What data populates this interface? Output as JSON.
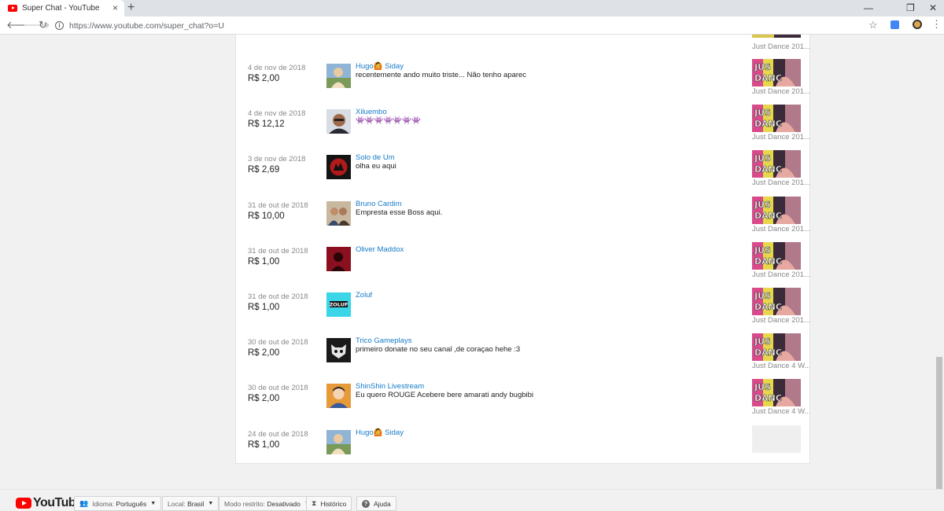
{
  "browser": {
    "tab_title": "Super Chat - YouTube",
    "close_glyph": "×",
    "new_tab_glyph": "+",
    "url": "https://www.youtube.com/super_chat?o=U",
    "window_controls": [
      "—",
      "❐",
      "✕"
    ]
  },
  "top_partial": {
    "thumb_title": "Just Dance 201..."
  },
  "rows": [
    {
      "date": "4 de nov de 2018",
      "amount": "R$ 2,00",
      "user": "Hugo🙆 Siday",
      "message": "recentemente ando muito triste... Não tenho aparec",
      "video_title": "Just Dance 201...",
      "avatar": "hugo"
    },
    {
      "date": "4 de nov de 2018",
      "amount": "R$ 12,12",
      "user": "Xiluembo",
      "message": "👾👾👾👾👾👾👾",
      "video_title": "Just Dance 201...",
      "avatar": "xiluembo"
    },
    {
      "date": "3 de nov de 2018",
      "amount": "R$ 2,69",
      "user": "Solo de Um",
      "message": "olha eu aqui",
      "video_title": "Just Dance 201...",
      "avatar": "solo"
    },
    {
      "date": "31 de out de 2018",
      "amount": "R$ 10,00",
      "user": "Bruno Cardim",
      "message": "Empresta esse Boss aqui.",
      "video_title": "Just Dance 201...",
      "avatar": "bruno"
    },
    {
      "date": "31 de out de 2018",
      "amount": "R$ 1,00",
      "user": "Oliver Maddox",
      "message": "",
      "video_title": "Just Dance 201...",
      "avatar": "oliver"
    },
    {
      "date": "31 de out de 2018",
      "amount": "R$ 1,00",
      "user": "Zoluf",
      "message": "",
      "video_title": "Just Dance 201...",
      "avatar": "zoluf"
    },
    {
      "date": "30 de out de 2018",
      "amount": "R$ 2,00",
      "user": "Trico Gameplays",
      "message": "primeiro donate no seu canal ,de coraçao hehe :3",
      "video_title": "Just Dance 4 W...",
      "avatar": "trico"
    },
    {
      "date": "30 de out de 2018",
      "amount": "R$ 2,00",
      "user": "ShinShin Livestream",
      "message": "Eu quero ROUGE Acebere bere amarati andy bugbibi",
      "video_title": "Just Dance 4 W...",
      "avatar": "shinshin"
    },
    {
      "date": "24 de out de 2018",
      "amount": "R$ 1,00",
      "user": "Hugo🙆 Siday",
      "message": "",
      "video_title": "",
      "avatar": "hugo"
    }
  ],
  "footer": {
    "logo_text": "YouTube",
    "language_key": "Idioma:",
    "language_value": "Português",
    "location_key": "Local:",
    "location_value": "Brasil",
    "restricted_key": "Modo restrito:",
    "restricted_value": "Desativado",
    "history_label": "Histórico",
    "help_label": "Ajuda"
  },
  "icons": {
    "back": "arrow-left-icon",
    "forward": "arrow-right-icon",
    "reload": "reload-icon",
    "star": "star-icon",
    "menu": "more-vert-icon",
    "history": "hourglass-icon",
    "help": "question-icon"
  }
}
